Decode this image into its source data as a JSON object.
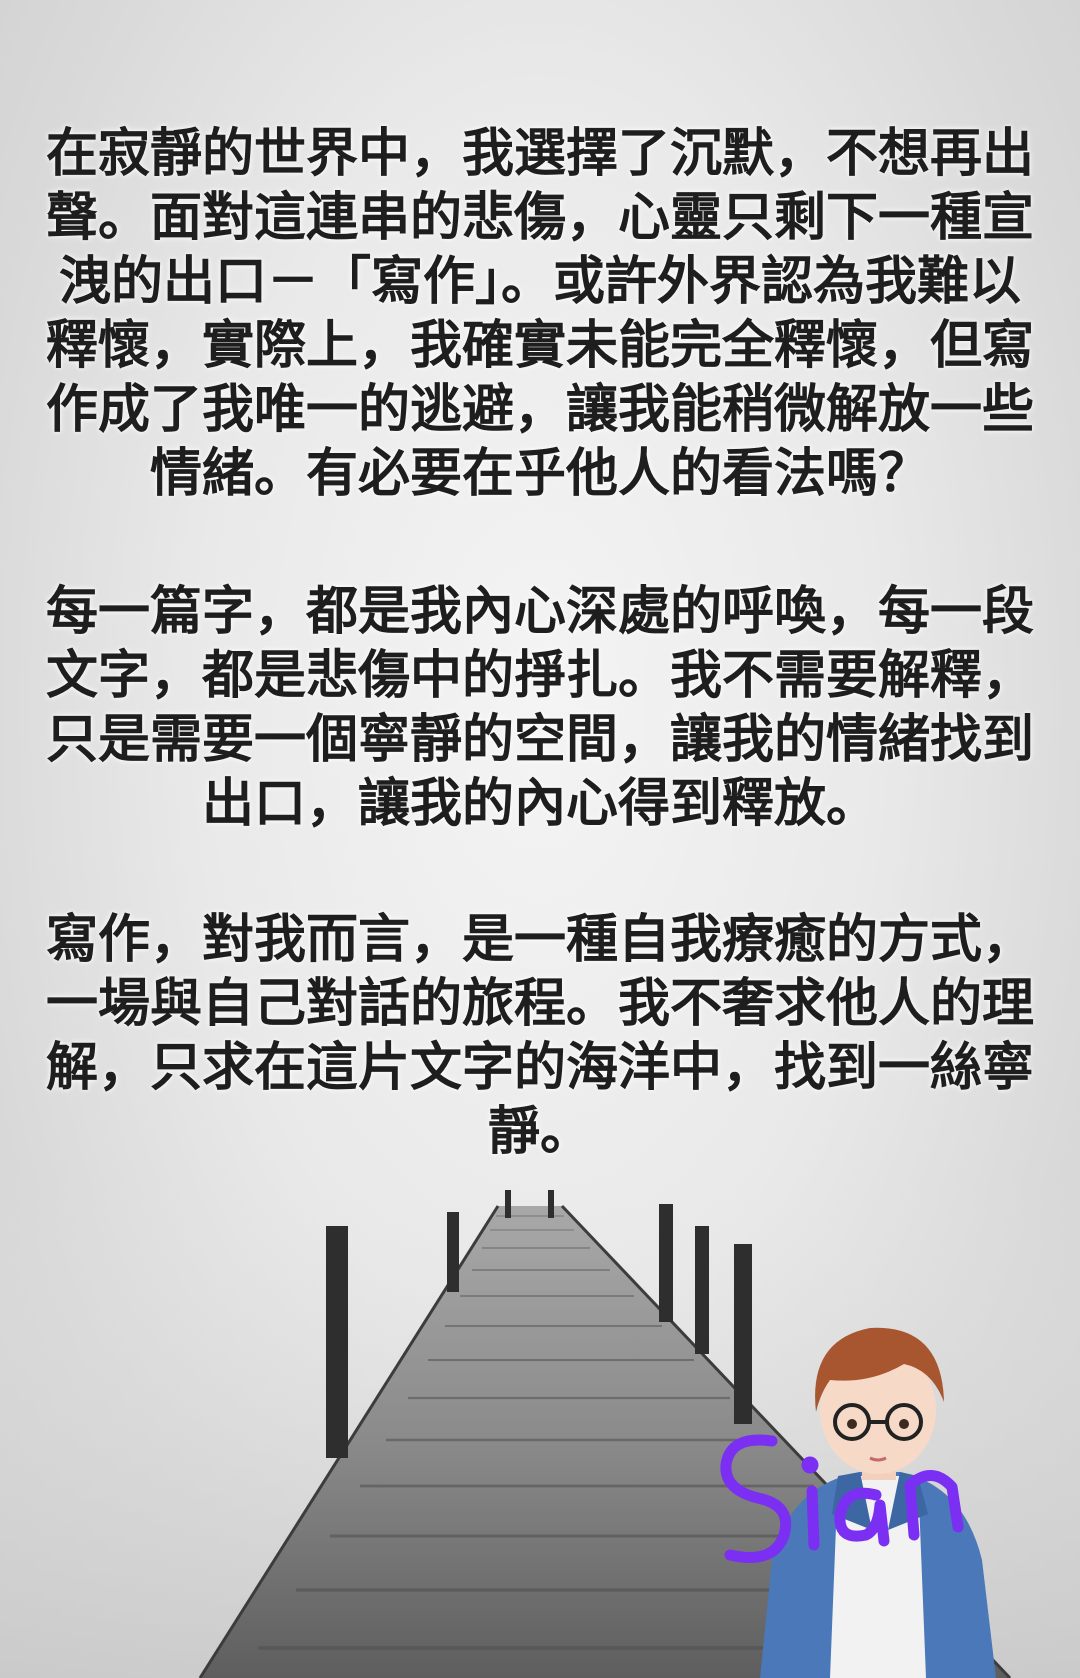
{
  "paragraphs": [
    {
      "lines": [
        "在寂靜的世界中，我選擇了沉默，不想再出",
        "聲。面對這連串的悲傷，心靈只剩下一種宣",
        "洩的出口－「寫作」。或許外界認為我難以",
        "釋懷，實際上，我確實未能完全釋懷，但寫",
        "作成了我唯一的逃避，讓我能稍微解放一些",
        "情緒。有必要在乎他人的看法嗎？"
      ]
    },
    {
      "lines": [
        "每一篇字，都是我內心深處的呼喚，每一段",
        "文字，都是悲傷中的掙扎。我不需要解釋，",
        "只是需要一個寧靜的空間，讓我的情緒找到",
        "出口，讓我的內心得到釋放。"
      ]
    },
    {
      "lines": [
        "寫作，對我而言，是一種自我療癒的方式，",
        "一場與自己對話的旅程。我不奢求他人的理",
        "解，只求在這片文字的海洋中，找到一絲寧",
        "靜。"
      ]
    }
  ],
  "signature": "Sian",
  "colors": {
    "text": "#1e1e1e",
    "signature": "#7b2ff2",
    "background": "#e6e6e6"
  }
}
